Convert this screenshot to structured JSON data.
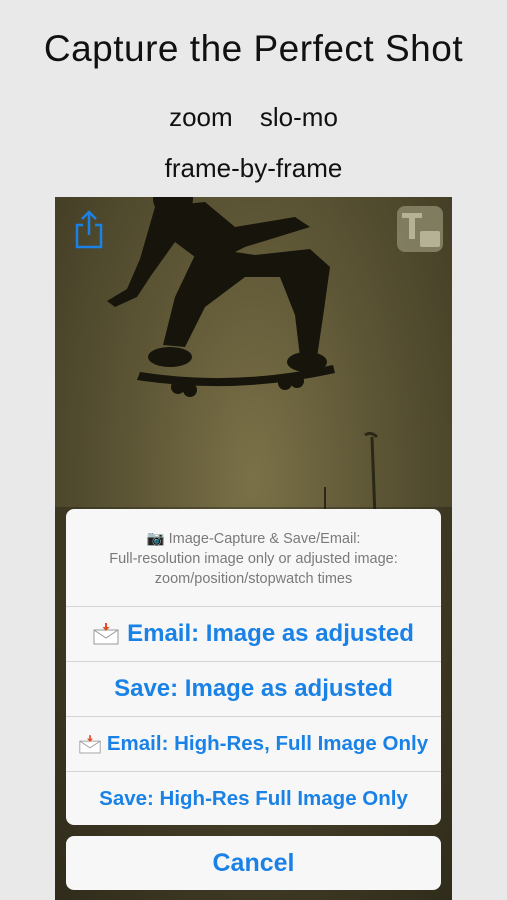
{
  "headline": "Capture the Perfect Shot",
  "features": {
    "zoom": "zoom",
    "slomo": "slo-mo",
    "frame": "frame-by-frame"
  },
  "toolbar": {
    "share_icon": "share-icon",
    "t_icon": "text-overlay-icon"
  },
  "action_sheet": {
    "camera_emoji": "📷",
    "message_line1": "Image-Capture & Save/Email:",
    "message_line2": "Full-resolution image only or adjusted image:",
    "message_line3": "zoom/position/stopwatch times",
    "actions": [
      {
        "label": "Email: Image as adjusted",
        "icon": "mail-icon"
      },
      {
        "label": "Save: Image as adjusted"
      },
      {
        "label": "Email: High-Res, Full Image Only",
        "icon": "mail-icon"
      },
      {
        "label": "Save: High-Res Full Image Only"
      }
    ],
    "cancel": "Cancel"
  },
  "colors": {
    "accent": "#1a82e6",
    "background": "#e9e9e9",
    "sheet": "#f7f7f7"
  }
}
